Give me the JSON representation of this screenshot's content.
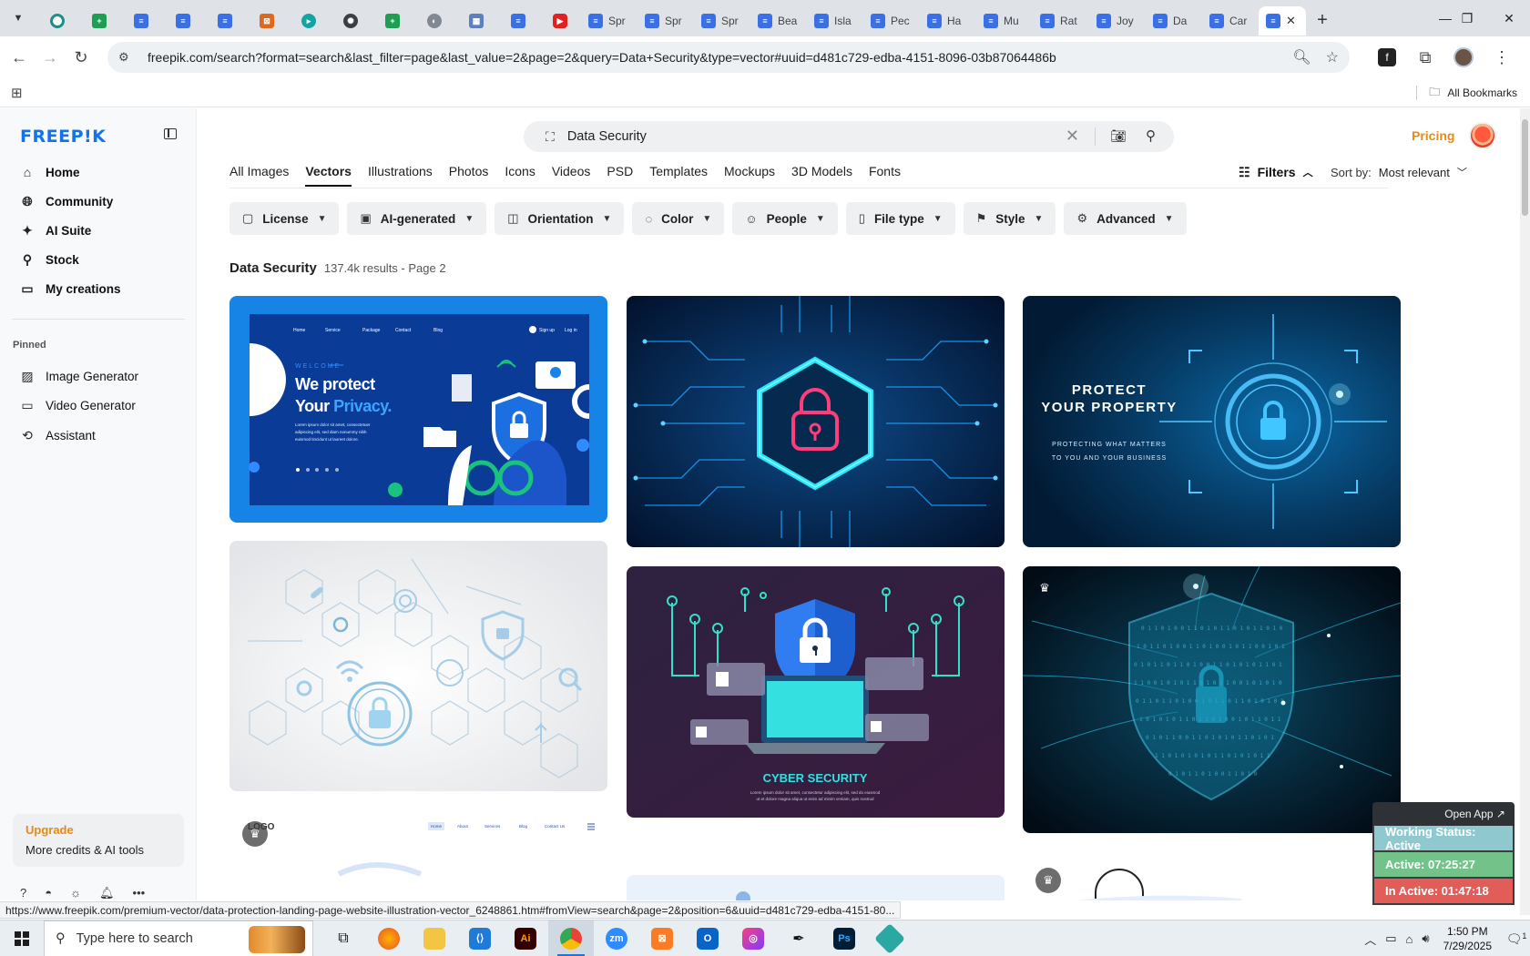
{
  "browser": {
    "tabs": [
      {
        "icon": "chevron-down-icon",
        "kind": "dropdown"
      },
      {
        "icon": "vpn-icon",
        "color": "#14a3a3"
      },
      {
        "icon": "sheets-icon",
        "color": "#1e9e52"
      },
      {
        "icon": "docs-icon",
        "color": "#3a6fe6"
      },
      {
        "icon": "docs-icon",
        "color": "#3a6fe6"
      },
      {
        "icon": "docs-icon",
        "color": "#3a6fe6"
      },
      {
        "icon": "grid-icon",
        "color": "#e0681d"
      },
      {
        "icon": "arrow-icon",
        "color": "#14a3a3"
      },
      {
        "icon": "openai-icon",
        "color": "#3b3f45"
      },
      {
        "icon": "sheets-icon",
        "color": "#1e9e52"
      },
      {
        "icon": "globe-icon",
        "color": "#808890"
      },
      {
        "icon": "qr-icon",
        "color": "#5b7fbf"
      },
      {
        "icon": "docs-icon",
        "color": "#3a6fe6"
      },
      {
        "icon": "youtube-icon",
        "color": "#e32020"
      }
    ],
    "titled_tabs": [
      "Spr",
      "Spr",
      "Spr",
      "Bea",
      "Isla",
      "Pec",
      "Ha",
      "Mu",
      "Rat",
      "Joy",
      "Da",
      "Car"
    ],
    "url": "freepik.com/search?format=search&last_filter=page&last_value=2&page=2&query=Data+Security&type=vector#uuid=d481c729-edba-4151-8096-03b87064486b",
    "all_bookmarks": "All Bookmarks",
    "status_link": "https://www.freepik.com/premium-vector/data-protection-landing-page-website-illustration-vector_6248861.htm#fromView=search&page=2&position=6&uuid=d481c729-edba-4151-80..."
  },
  "sidebar": {
    "logo": "FREEP!K",
    "nav": [
      {
        "label": "Home",
        "icon": "home-icon"
      },
      {
        "label": "Community",
        "icon": "globe-icon"
      },
      {
        "label": "AI Suite",
        "icon": "sparkle-icon"
      },
      {
        "label": "Stock",
        "icon": "search-icon"
      },
      {
        "label": "My creations",
        "icon": "folder-icon"
      }
    ],
    "pinned_title": "Pinned",
    "pinned": [
      {
        "label": "Image Generator",
        "icon": "image-icon"
      },
      {
        "label": "Video Generator",
        "icon": "video-icon"
      },
      {
        "label": "Assistant",
        "icon": "assistant-icon"
      }
    ],
    "upgrade_title": "Upgrade",
    "upgrade_sub": "More credits & AI tools"
  },
  "header": {
    "query": "Data Security",
    "pricing": "Pricing"
  },
  "type_tabs": [
    "All Images",
    "Vectors",
    "Illustrations",
    "Photos",
    "Icons",
    "Videos",
    "PSD",
    "Templates",
    "Mockups",
    "3D Models",
    "Fonts"
  ],
  "active_type_tab": "Vectors",
  "filters_label": "Filters",
  "sort_label": "Sort by:",
  "sort_value": "Most relevant",
  "chips": [
    {
      "label": "License",
      "icon": "license-icon"
    },
    {
      "label": "AI-generated",
      "icon": "ai-icon"
    },
    {
      "label": "Orientation",
      "icon": "orientation-icon"
    },
    {
      "label": "Color",
      "icon": "palette-icon"
    },
    {
      "label": "People",
      "icon": "people-icon"
    },
    {
      "label": "File type",
      "icon": "file-icon"
    },
    {
      "label": "Style",
      "icon": "brush-icon"
    },
    {
      "label": "Advanced",
      "icon": "gear-icon"
    }
  ],
  "results": {
    "heading": "Data Security",
    "count": "137.4k results - Page 2"
  },
  "cards": {
    "c1": {
      "nav": [
        "Home",
        "Service",
        "Package",
        "Contact",
        "Blog"
      ],
      "signup": "Sign up",
      "login": "Log in",
      "welcome": "WELCOME",
      "line1": "We protect",
      "line2a": "Your ",
      "line2b": "Privacy.",
      "body1": "Lorem ipsum dolor sit amet, consectetuer",
      "body2": "adipiscing elit, sed diam nonummy nibh",
      "body3": "euismod tincidunt ut laoreet dolore."
    },
    "c3": {
      "line1": "PROTECT",
      "line2": "YOUR PROPERTY",
      "sub1": "PROTECTING WHAT MATTERS",
      "sub2": "TO YOU AND YOUR BUSINESS"
    },
    "c5": {
      "title": "CYBER SECURITY",
      "sub1": "Lorem ipsum dolor sit amet, consectetur adipiscing elit, sed do eiusmod",
      "sub2": "ut et dolore magna aliqua ut enim ad minim veniam, quis nostrud"
    },
    "c7": {
      "logo": "LOGO",
      "nav": [
        "Home",
        "About",
        "Services",
        "Blog",
        "Contact Us"
      ]
    }
  },
  "working_status": {
    "open_app": "Open App ↗",
    "status": "Working Status: Active",
    "active": "Active: 07:25:27",
    "inactive": "In Active: 01:47:18"
  },
  "taskbar": {
    "search_placeholder": "Type here to search",
    "time": "1:50 PM",
    "date": "7/29/2025",
    "notifications": "1"
  }
}
